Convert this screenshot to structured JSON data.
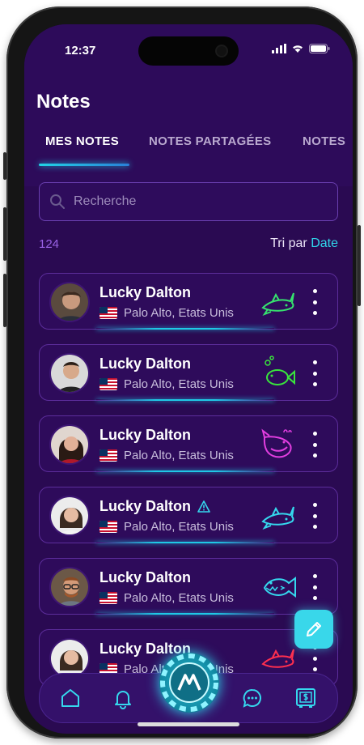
{
  "status_bar": {
    "time": "12:37"
  },
  "page": {
    "title": "Notes"
  },
  "tabs": [
    {
      "label": "MES NOTES",
      "active": true
    },
    {
      "label": "NOTES PARTAGÉES",
      "active": false
    },
    {
      "label": "NOTES",
      "active": false
    }
  ],
  "search": {
    "placeholder": "Recherche"
  },
  "list_meta": {
    "count": "124",
    "sort_label": "Tri par",
    "sort_value": "Date"
  },
  "notes": [
    {
      "name": "Lucky Dalton",
      "location": "Palo Alto, Etats Unis",
      "fish_icon": "shark-icon",
      "fish_color": "#36e36e",
      "warning": false
    },
    {
      "name": "Lucky Dalton",
      "location": "Palo Alto, Etats Unis",
      "fish_icon": "fish-icon",
      "fish_color": "#39e53c",
      "warning": false
    },
    {
      "name": "Lucky Dalton",
      "location": "Palo Alto, Etats Unis",
      "fish_icon": "whale-icon",
      "fish_color": "#e23ee0",
      "warning": false
    },
    {
      "name": "Lucky Dalton",
      "location": "Palo Alto, Etats Unis",
      "fish_icon": "shark-icon",
      "fish_color": "#35d8ee",
      "warning": true
    },
    {
      "name": "Lucky Dalton",
      "location": "Palo Alto, Etats Unis",
      "fish_icon": "piranha-icon",
      "fish_color": "#35d8ee",
      "warning": false
    },
    {
      "name": "Lucky Dalton",
      "location": "Palo Alto, Etats Unis",
      "fish_icon": "shark-icon",
      "fish_color": "#ff2f4f",
      "warning": false
    }
  ],
  "colors": {
    "accent": "#30d6ea",
    "background": "#2a0a52",
    "count": "#9a62e6"
  }
}
